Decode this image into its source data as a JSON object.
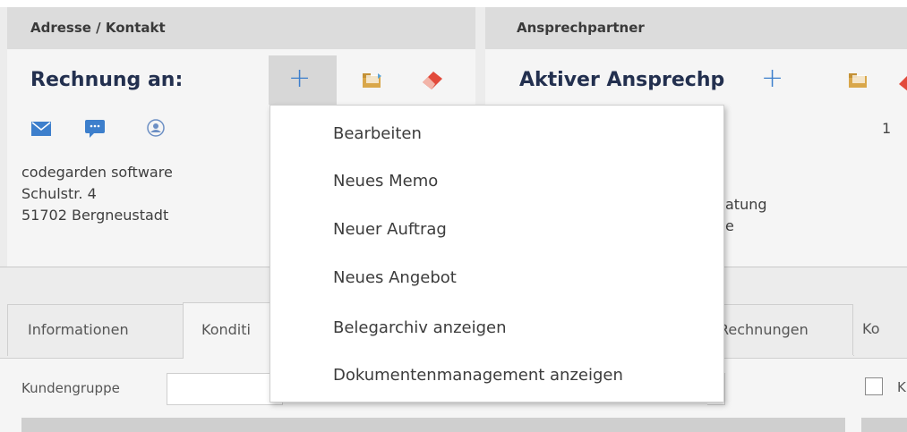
{
  "left_panel": {
    "header": "Adresse / Kontakt",
    "title": "Rechnung an:",
    "address": [
      "codegarden software",
      "Schulstr. 4",
      "51702 Bergneustadt"
    ],
    "icons": [
      "plus-icon",
      "folder-icon",
      "eraser-icon",
      "mail-icon",
      "message-icon",
      "contact-icon"
    ]
  },
  "right_panel": {
    "header": "Ansprechpartner",
    "title": "Aktiver Ansprechp",
    "count": "1",
    "partial_text_1": "atung",
    "partial_text_2": "e"
  },
  "tabs": [
    {
      "label": "Informationen"
    },
    {
      "label": "Konditi"
    },
    {
      "label": "Rechnungen"
    },
    {
      "label": "Ko"
    }
  ],
  "form": {
    "kundengruppe_label": "Kundengruppe",
    "checkbox_partial": "K"
  },
  "context_menu": {
    "items": [
      "Bearbeiten",
      "Neues Memo",
      "Neuer Auftrag",
      "Neues Angebot",
      "Belegarchiv anzeigen",
      "Dokumentenmanagement anzeigen"
    ]
  },
  "colors": {
    "accent": "#3d7fcc",
    "title": "#23304f",
    "eraser": "#e24a3b",
    "folder": "#d9a74a"
  }
}
